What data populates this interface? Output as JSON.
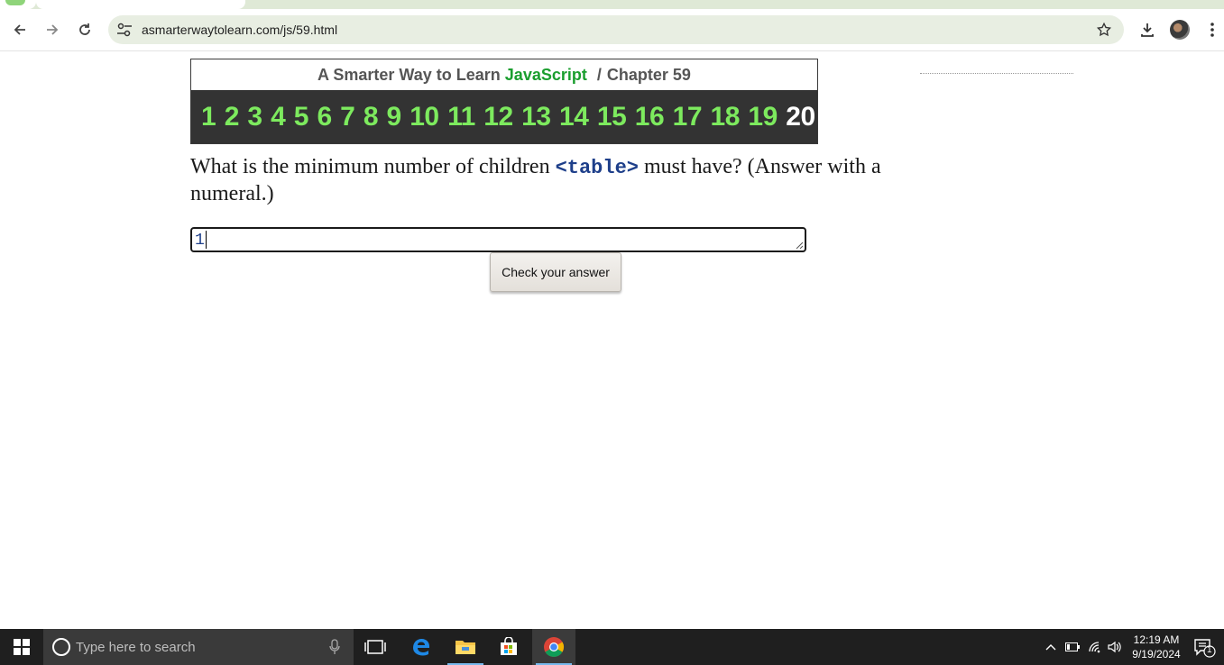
{
  "browser": {
    "url": "asmarterwaytolearn.com/js/59.html"
  },
  "header": {
    "title_prefix": "A Smarter Way to Learn",
    "title_js": "JavaScript",
    "title_sep": "/",
    "chapter": "Chapter 59",
    "numbers": [
      "1",
      "2",
      "3",
      "4",
      "5",
      "6",
      "7",
      "8",
      "9",
      "10",
      "11",
      "12",
      "13",
      "14",
      "15",
      "16",
      "17",
      "18",
      "19",
      "20"
    ],
    "current_number": "20"
  },
  "question": {
    "text_before": "What is the minimum number of children",
    "code": "<table>",
    "text_after": "must have? (Answer with a numeral.)"
  },
  "answer": {
    "value": "1"
  },
  "check_button": {
    "label": "Check your answer"
  },
  "taskbar": {
    "search_placeholder": "Type here to search",
    "time": "12:19 AM",
    "date": "9/19/2024",
    "notification_count": "1"
  },
  "colors": {
    "number_link": "#7dea5e",
    "current_number": "#ffffff",
    "javascript_accent": "#1a9e2e",
    "code_blue": "#1e3f8a"
  }
}
